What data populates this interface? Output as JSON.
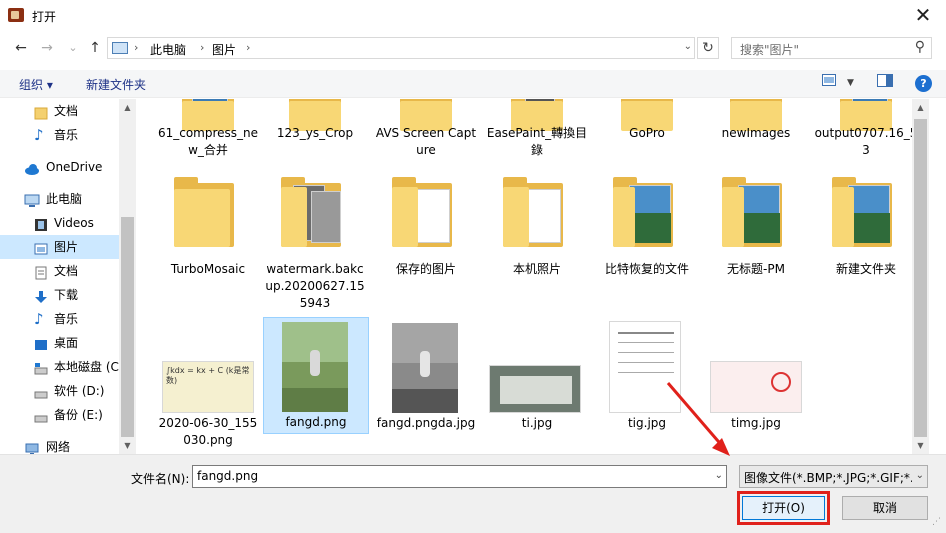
{
  "window": {
    "title": "打开",
    "close_glyph": "✕"
  },
  "address": {
    "back_glyph": "←",
    "forward_glyph": "→",
    "dropdown_glyph": "⌄",
    "up_glyph": "↑",
    "chevron_glyph": "›",
    "crumbs": [
      "此电脑",
      "图片"
    ],
    "refresh_glyph": "↻"
  },
  "search": {
    "placeholder": "搜索\"图片\"",
    "icon_glyph": "⚲"
  },
  "toolbar": {
    "organize": "组织 ▾",
    "new_folder": "新建文件夹",
    "help": "?"
  },
  "sidebar": {
    "items": [
      {
        "label": "文档",
        "icon": "folder-icon",
        "selected": false
      },
      {
        "label": "音乐",
        "icon": "music-note-icon",
        "selected": false
      },
      {
        "label": "OneDrive",
        "icon": "cloud-icon",
        "selected": false
      },
      {
        "label": "此电脑",
        "icon": "computer-icon",
        "selected": false
      },
      {
        "label": "Videos",
        "icon": "film-icon",
        "selected": false
      },
      {
        "label": "图片",
        "icon": "picture-icon",
        "selected": true
      },
      {
        "label": "文档",
        "icon": "document-icon",
        "selected": false
      },
      {
        "label": "下载",
        "icon": "download-arrow-icon",
        "selected": false
      },
      {
        "label": "音乐",
        "icon": "music-note-icon",
        "selected": false
      },
      {
        "label": "桌面",
        "icon": "desktop-icon",
        "selected": false
      },
      {
        "label": "本地磁盘 (C",
        "icon": "windows-drive-icon",
        "selected": false
      },
      {
        "label": "软件 (D:)",
        "icon": "drive-icon",
        "selected": false
      },
      {
        "label": "备份 (E:)",
        "icon": "drive-icon",
        "selected": false
      },
      {
        "label": "网络",
        "icon": "network-icon",
        "selected": false
      }
    ]
  },
  "files": {
    "row1": [
      "61_compress_new_合并",
      "123_ys_Crop",
      "AVS Screen Capture",
      "EasePaint_轉換目錄",
      "GoPro",
      "newImages",
      "output0707.16_53"
    ],
    "row2": [
      "TurboMosaic",
      "watermark.bakcup.20200627.155943",
      "保存的图片",
      "本机照片",
      "比特恢复的文件",
      "无标题-PM",
      "新建文件夹"
    ],
    "row3": [
      "2020-06-30_155030.png",
      "fangd.png",
      "fangd.pngda.jpg",
      "ti.jpg",
      "tig.jpg",
      "timg.jpg"
    ],
    "selected": "fangd.png"
  },
  "formula_text": "∫kdx = kx + C (k是常数)",
  "scroll": {
    "up_glyph": "▲",
    "down_glyph": "▼"
  },
  "footer": {
    "filename_label": "文件名(N):",
    "filename_value": "fangd.png",
    "filter_value": "图像文件(*.BMP;*.JPG;*.GIF;*.PNG)",
    "dropdown_glyph": "⌄",
    "open_button": "打开(O)",
    "cancel_button": "取消"
  },
  "colors": {
    "accent": "#0078d7",
    "selection": "#cce8ff",
    "highlight_red": "#e0211b"
  }
}
